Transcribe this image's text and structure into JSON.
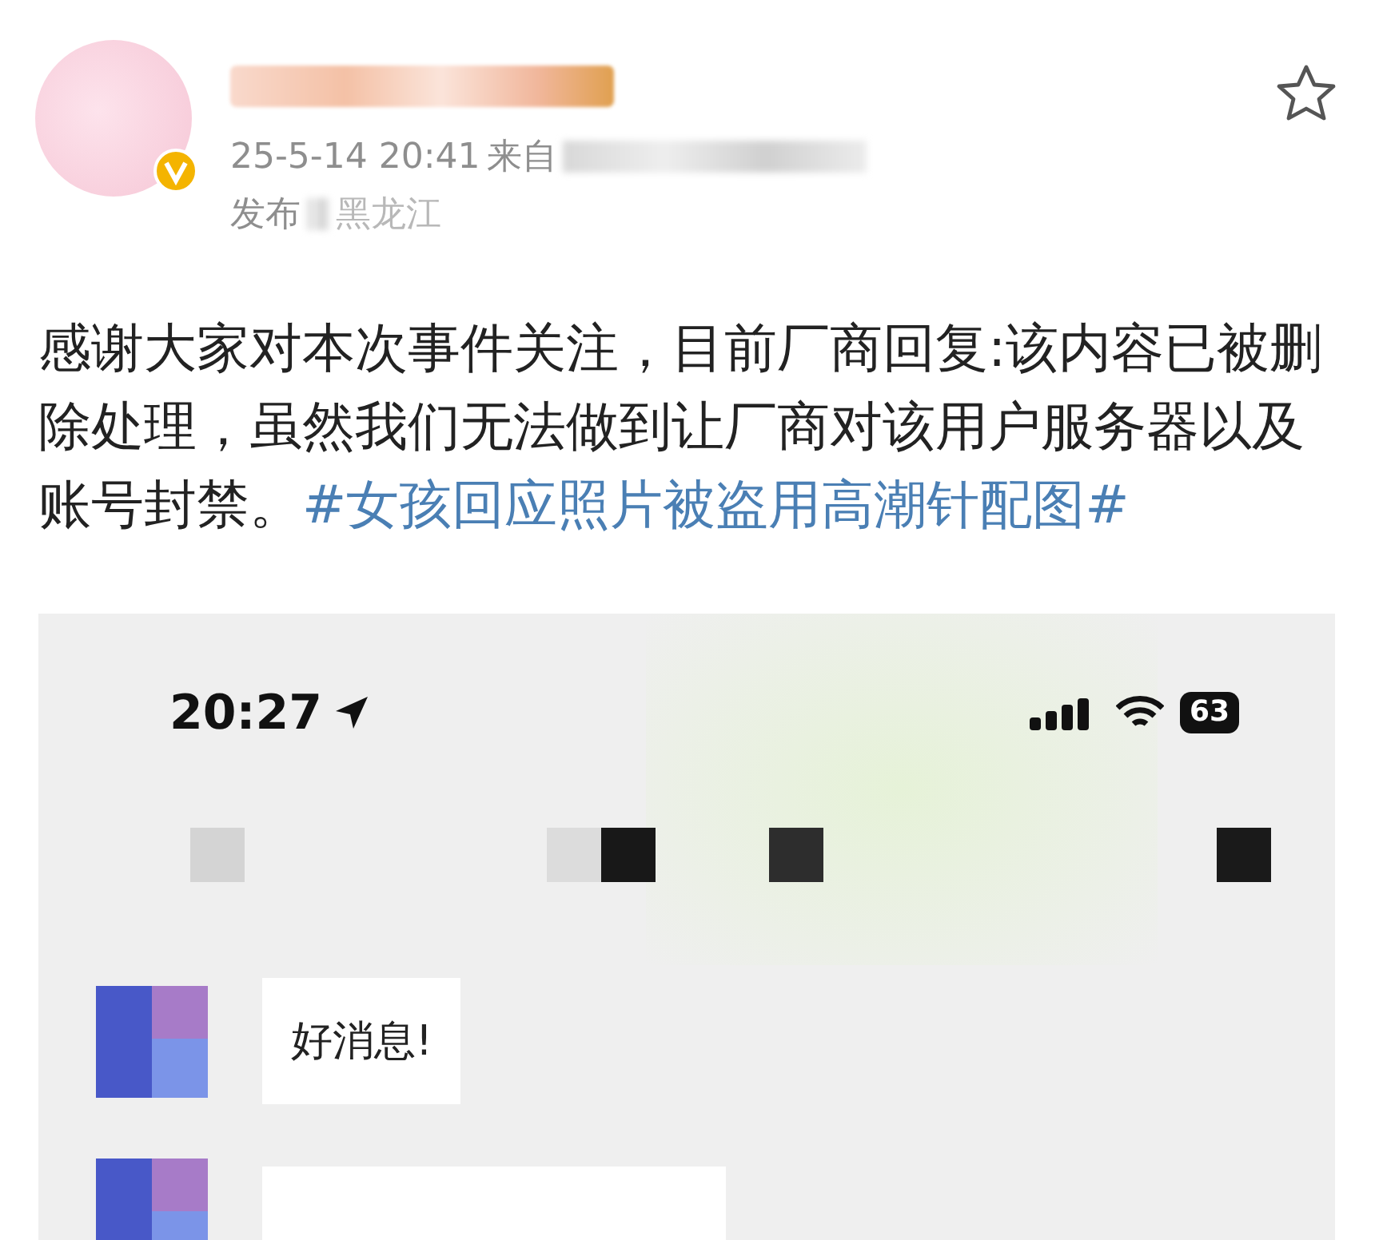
{
  "post": {
    "timestamp": "25-5-14 20:41",
    "source_label": "来自",
    "location_prefix": "发布",
    "location": "黑龙江",
    "favorited": false,
    "text": "感谢大家对本次事件关注，目前厂商回复:该内容已被删除处理，虽然我们无法做到让厂商对该用户服务器以及账号封禁。",
    "hashtag": "#女孩回应照片被盗用高潮针配图#"
  },
  "screenshot": {
    "status_time": "20:27",
    "battery": "63",
    "messages": [
      {
        "text": "好消息!"
      }
    ]
  }
}
